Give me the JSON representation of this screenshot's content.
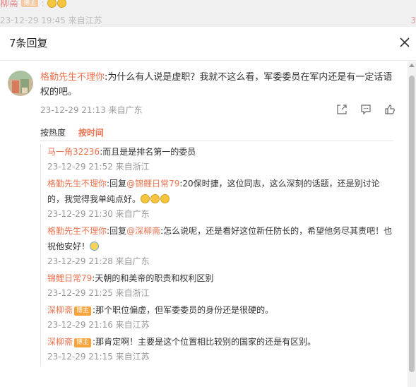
{
  "background": {
    "line1_name": "柳斋",
    "line1_badge": "博主",
    "line1_rest": ":",
    "line2": "23-12-29 19:45 来自江苏",
    "right_num": "3"
  },
  "modal": {
    "title": "7条回复"
  },
  "comment": {
    "user": "格勤先生不理你",
    "text": ":为什么有人说是虚职？我就不这么看，军委委员在军内还是有一定话语权的吧。",
    "meta": "23-12-29 21:13 来自广东"
  },
  "sort": {
    "hot": "按热度",
    "time": "按时间"
  },
  "replies": [
    {
      "user": "马一角32236",
      "badge": "",
      "text": ":而且是是排名第一的委员",
      "meta": "23-12-29 21:52 来自浙江"
    },
    {
      "user": "格勤先生不理你",
      "badge": "",
      "text": ":回复",
      "mention": "@锦鲤日常79",
      "text2": ":20保时捷，这位同志，这么深刻的话题，还是别讨论的，我觉得我单纯点好。",
      "meta": "23-12-29 21:30 来自广东"
    },
    {
      "user": "格勤先生不理你",
      "badge": "",
      "text": ":回复",
      "mention": "@深柳斋",
      "text2": ":怎么说呢，还是看好这位新任防长的，希望他务尽其责吧！也祝他安好！",
      "meta": "23-12-29 21:28 来自广东"
    },
    {
      "user": "锦鲤日常79",
      "badge": "",
      "text": ":天朝的和美帝的职责和权利区别",
      "meta": "23-12-29 21:25 来自浙江"
    },
    {
      "user": "深柳斋",
      "badge": "博主",
      "text": ":那个职位偏虚，但军委委员的身份还是很硬的。",
      "meta": "23-12-29 21:16 来自江苏"
    },
    {
      "user": "深柳斋",
      "badge": "博主",
      "text": ":那肯定啊！主要是这个位置相比较别的国家的还是有区别。",
      "meta": "23-12-29 21:15 来自江苏"
    }
  ],
  "colors": {
    "username": "#eb7350",
    "badge": "#f7a53b",
    "meta": "#999999"
  }
}
